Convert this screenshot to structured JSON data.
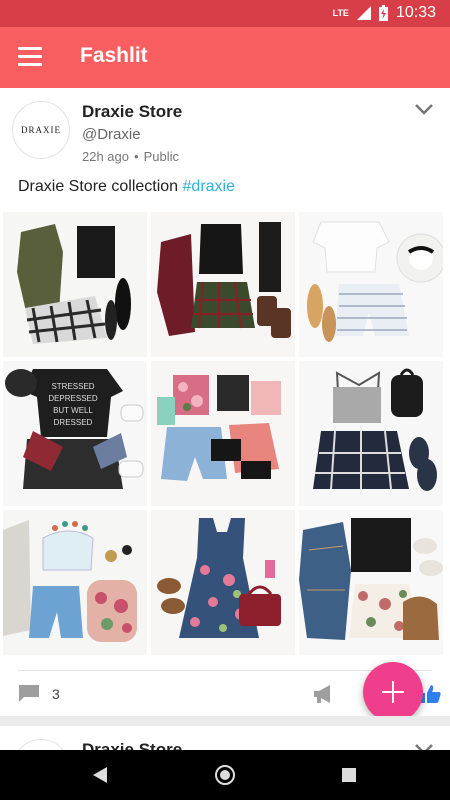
{
  "status_bar": {
    "network": "LTE",
    "time": "10:33"
  },
  "app_bar": {
    "title": "Fashlit"
  },
  "post": {
    "avatar_text": "DRAXIE",
    "store_name": "Draxie Store",
    "handle": "@Draxie",
    "time_ago": "22h ago",
    "visibility": "Public",
    "caption_text": "Draxie Store collection ",
    "hashtag": "#draxie",
    "comment_count": "3",
    "images": [
      "outfit-olive-jacket-plaid-skirt",
      "outfit-burgundy-cardigan-tartan-skirt",
      "outfit-white-tee-striped-shorts-hat",
      "outfit-stressed-depressed-tee-flannel",
      "outfit-floral-crop-tops-denim-shorts",
      "outfit-grey-cami-plaid-skirt-backpack",
      "outfit-white-bustier-floral-backpack",
      "outfit-floral-skater-dress-red-bag",
      "outfit-denim-jacket-floral-skirt"
    ]
  },
  "next_post": {
    "store_name": "Draxie Store"
  },
  "colors": {
    "status_bar": "#d73e48",
    "app_bar": "#f95e60",
    "hashtag": "#2bb2d6",
    "fab": "#ee3e8c",
    "like": "#2f80ed"
  }
}
